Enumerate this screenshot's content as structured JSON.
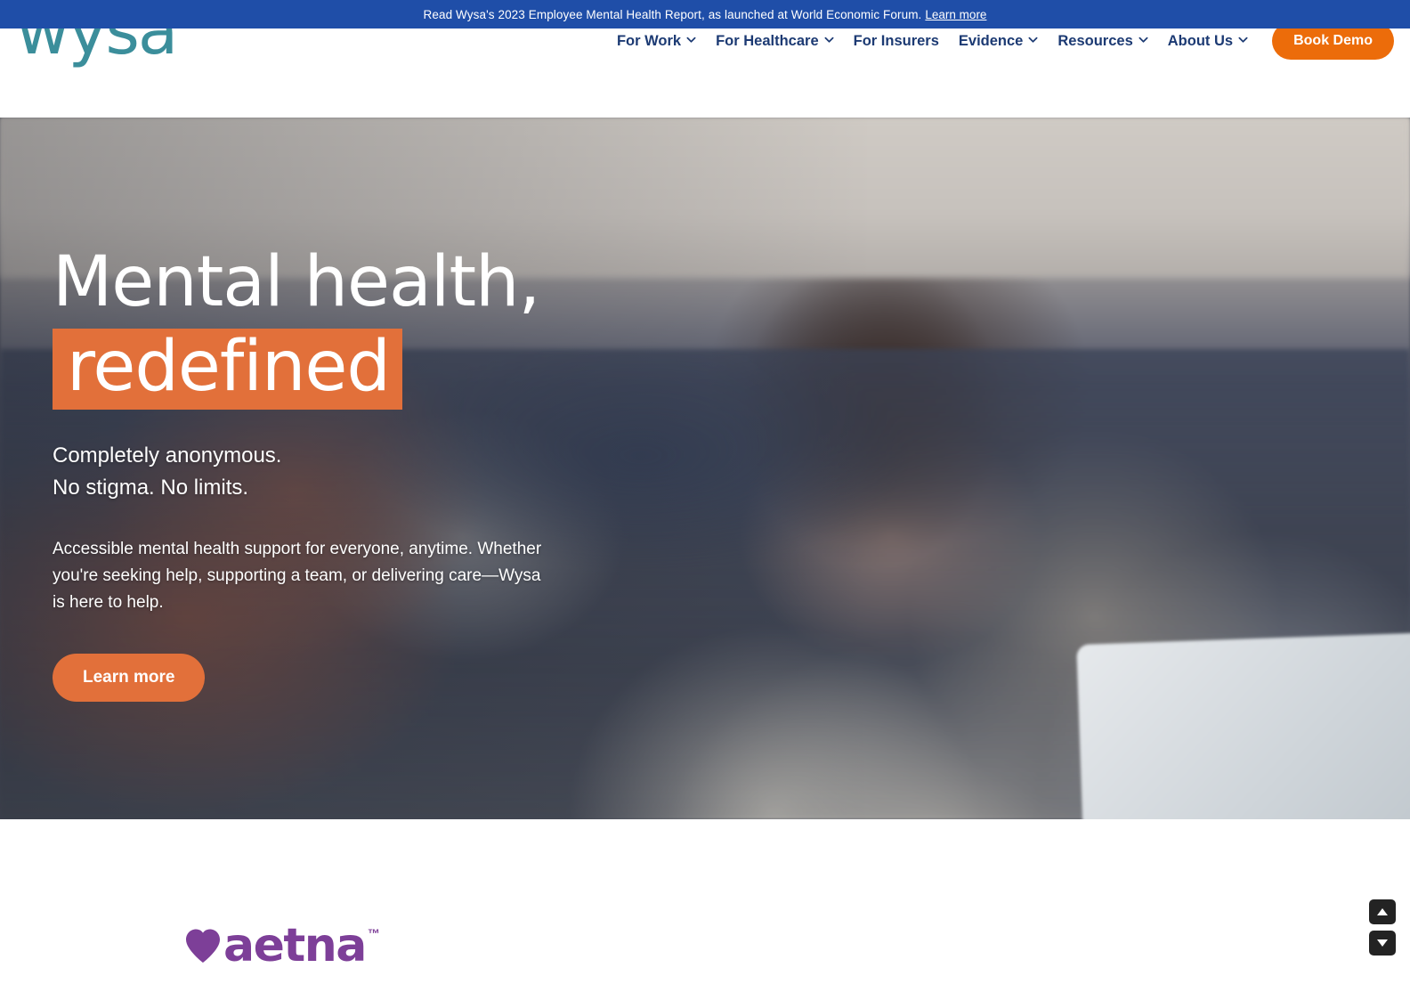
{
  "banner": {
    "text": "Read Wysa's 2023 Employee Mental Health Report, as launched at World Economic Forum.",
    "link_label": "Learn more"
  },
  "header": {
    "logo_text": "wysa",
    "nav_items": [
      {
        "label": "For Work",
        "has_dropdown": true
      },
      {
        "label": "For Healthcare",
        "has_dropdown": true
      },
      {
        "label": "For Insurers",
        "has_dropdown": false
      },
      {
        "label": "Evidence",
        "has_dropdown": true
      },
      {
        "label": "Resources",
        "has_dropdown": true
      },
      {
        "label": "About Us",
        "has_dropdown": true
      }
    ],
    "cta_label": "Book Demo"
  },
  "hero": {
    "heading_line1": "Mental health,",
    "heading_line2_highlighted": "redefined",
    "subheading": "Completely anonymous.\nNo stigma. No limits.",
    "body": "Accessible mental health support for everyone, anytime. Whether you're seeking help, supporting a team, or delivering care—Wysa is here to help.",
    "cta_label": "Learn more"
  },
  "partners": {
    "logos": [
      {
        "name": "aetna",
        "word": "aetna",
        "trademark": "™"
      }
    ]
  },
  "scroll_controls": {
    "up_label": "▲",
    "down_label": "▼"
  },
  "colors": {
    "banner_blue": "#1f4ea8",
    "nav_navy": "#1c3a73",
    "brand_orange": "#ec6c0a",
    "highlight_orange": "#e2703a",
    "logo_teal": "#3b8e9b",
    "aetna_purple": "#7d3f98"
  }
}
